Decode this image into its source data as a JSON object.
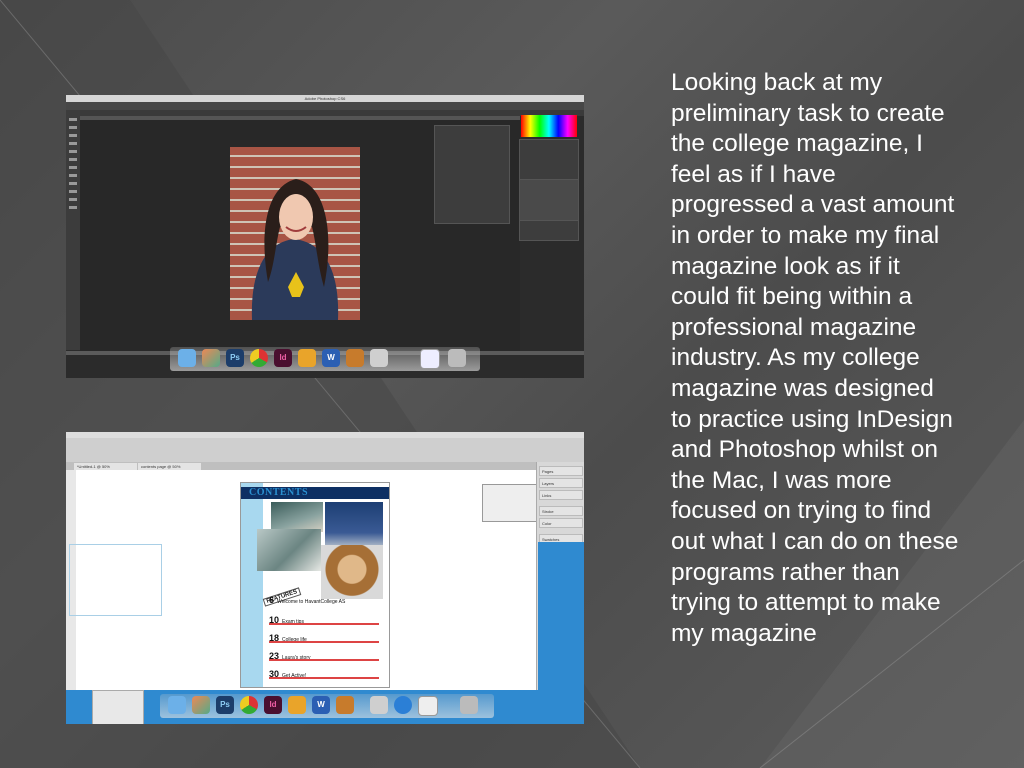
{
  "slide": {
    "body_text": "Looking back at my preliminary task to create the college magazine, I feel as if I have progressed a vast amount in order to make my final magazine look as if it could fit being within a professional magazine industry. As my college magazine was designed to practice using InDesign and Photoshop whilst on the Mac, I was more focused on trying to find out what I can do on these programs rather than trying to attempt to make my magazine",
    "colors": {
      "background": "#505050",
      "text": "#ffffff",
      "desktop_blue": "#2f8ad0",
      "contents_bar": "#0d2f63"
    }
  },
  "screenshot_photoshop": {
    "app_title": "Adobe Photoshop CS6",
    "dock_icons": [
      "finder-icon",
      "photos-icon",
      "photoshop-icon",
      "chrome-icon",
      "indesign-icon",
      "pages-icon",
      "word-icon",
      "garageband-icon",
      "preview-icon",
      "finder-window-icon",
      "trash-icon"
    ],
    "dock_labels": {
      "ps": "Ps",
      "id": "Id",
      "w": "W"
    }
  },
  "screenshot_indesign": {
    "tabs": [
      "*Untitled-1 @ 50%",
      "contents page @ 50%"
    ],
    "right_panel_items": [
      "Pages",
      "Layers",
      "Links",
      "Stroke",
      "Color",
      "Swatches"
    ],
    "contents_title": "CONTENTS",
    "page_number_tag": "FEATURES",
    "toc": [
      {
        "num": "6",
        "label": "Welcome to HavantCollege AS"
      },
      {
        "num": "10",
        "label": "Exam tips"
      },
      {
        "num": "18",
        "label": "College life"
      },
      {
        "num": "23",
        "label": "Laura's story"
      },
      {
        "num": "30",
        "label": "Get Active!"
      }
    ],
    "dock_labels": {
      "ps": "Ps",
      "id": "Id",
      "w": "W"
    }
  }
}
